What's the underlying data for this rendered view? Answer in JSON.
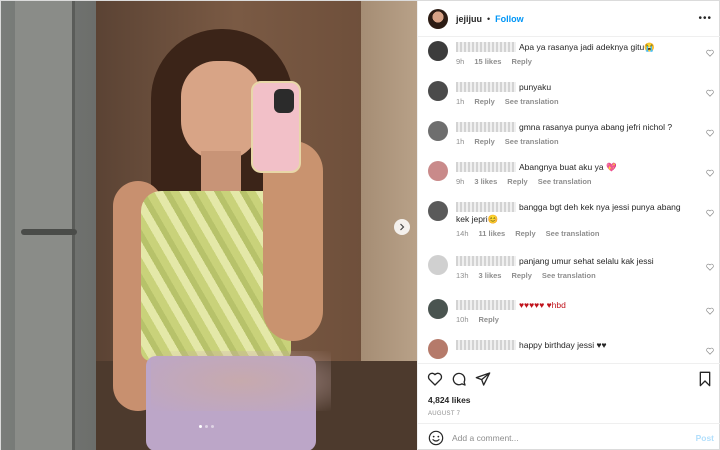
{
  "post": {
    "username": "jejijuu",
    "separator": "•",
    "follow_label": "Follow",
    "more_label": "•••",
    "likes_text": "4,824 likes",
    "date_text": "AUGUST 7",
    "add_comment_placeholder": "Add a comment...",
    "post_label": "Post"
  },
  "comments": [
    {
      "text": "Apa ya rasanya jadi adeknya gitu😭",
      "age": "9h",
      "likes": "15 likes",
      "reply": "Reply",
      "translate": "",
      "avatar_color": "#3c3c3c"
    },
    {
      "text": "punyaku",
      "age": "1h",
      "likes": "",
      "reply": "Reply",
      "translate": "See translation",
      "avatar_color": "#4b4b4b"
    },
    {
      "text": "gmna rasanya punya abang jefri nichol ?",
      "age": "1h",
      "likes": "",
      "reply": "Reply",
      "translate": "See translation",
      "avatar_color": "#6e6e6e"
    },
    {
      "text": "Abangnya buat aku ya 💖",
      "age": "9h",
      "likes": "3 likes",
      "reply": "Reply",
      "translate": "See translation",
      "avatar_color": "#c98a8a"
    },
    {
      "text": "bangga bgt deh kek nya jessi punya abang kek jepri😊",
      "age": "14h",
      "likes": "11 likes",
      "reply": "Reply",
      "translate": "See translation",
      "avatar_color": "#5a5a5a"
    },
    {
      "text": "panjang umur sehat selalu kak jessi",
      "age": "13h",
      "likes": "3 likes",
      "reply": "Reply",
      "translate": "See translation",
      "avatar_color": "#d0d0d0"
    },
    {
      "text": "♥♥♥♥♥ ♥hbd",
      "age": "10h",
      "likes": "",
      "reply": "Reply",
      "translate": "",
      "avatar_color": "#4a5450"
    },
    {
      "text": "happy birthday jessi ♥♥",
      "age": "",
      "likes": "",
      "reply": "",
      "translate": "",
      "avatar_color": "#b57a6a"
    }
  ],
  "icons": {
    "next": "chevron-right-icon",
    "like": "heart-icon",
    "comment": "comment-icon",
    "share": "send-icon",
    "save": "bookmark-icon",
    "emoji": "smiley-icon"
  },
  "colors": {
    "follow": "#0095f6",
    "post_disabled": "#b2dffc",
    "meta": "#8e8e8e"
  }
}
